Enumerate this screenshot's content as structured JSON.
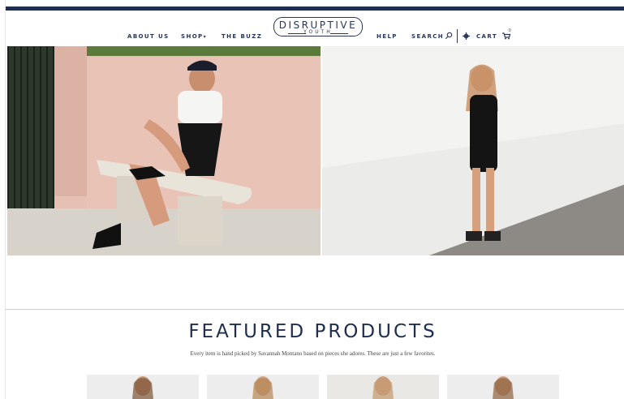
{
  "nav": {
    "items": [
      "ABOUT US",
      "SHOP",
      "THE BUZZ",
      "HELP",
      "SEARCH",
      "CART"
    ],
    "cart_count": "0"
  },
  "logo": {
    "main": "DISRUPTIVE",
    "sub": "YOUTH"
  },
  "hero": {
    "left_image": "model-seated-on-bench-photo",
    "right_image": "model-leaning-on-wall-photo"
  },
  "featured": {
    "title": "FEATURED PRODUCTS",
    "subtitle": "Every item is hand picked by Savannah Montano based on pieces she adores. These are just a few favorites."
  },
  "products": [
    {
      "name": "product-thumb-1"
    },
    {
      "name": "product-thumb-2"
    },
    {
      "name": "product-thumb-3"
    },
    {
      "name": "product-thumb-4"
    }
  ],
  "colors": {
    "navy": "#1f2d4e",
    "accent_rule": "#e8c3b1"
  }
}
